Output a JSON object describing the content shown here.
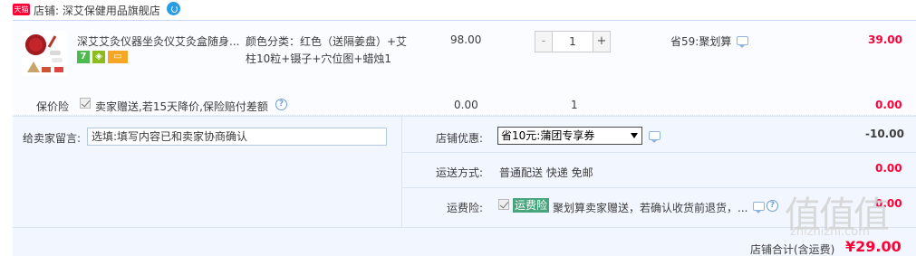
{
  "shop": {
    "badge": "天猫",
    "name": "店铺: 深艾保健用品旗舰店"
  },
  "item": {
    "title": "深艾艾灸仪器坐灸仪艾灸盒随身...",
    "service_icons": [
      "7",
      "cube",
      "card"
    ],
    "sku": "颜色分类：红色（送隔姜盘）+艾柱10粒+镊子+穴位图+蜡烛1",
    "unit_price": "98.00",
    "quantity": "1",
    "qty_minus": "-",
    "qty_plus": "+",
    "promo": "省59:聚划算",
    "subtotal": "39.00"
  },
  "insurance": {
    "label": "保价险",
    "desc": "卖家赠送,若15天降价,保险赔付差额",
    "help": "?",
    "price": "0.00",
    "qty": "1",
    "total": "0.00"
  },
  "message": {
    "label": "给卖家留言:",
    "placeholder": "选填:填写内容已和卖家协商确认"
  },
  "discount": {
    "label": "店铺优惠:",
    "selected": "省10元:蒲团专享券",
    "total": "-10.00"
  },
  "shipping": {
    "label": "运送方式:",
    "value": "普通配送 快递 免邮",
    "total": "0.00"
  },
  "freight": {
    "label": "运费险:",
    "badge": "运费险",
    "desc": "聚划算卖家赠送，若确认收货前退货，...",
    "help": "?",
    "total": "0.00"
  },
  "summary": {
    "label": "店铺合计(含运费)",
    "total": "¥29.00"
  },
  "watermark": {
    "big": "值值值",
    "small": "zhizhizhi.com"
  },
  "colors": {
    "accent_red": "#ff0036",
    "panel_blue": "#f2f7ff",
    "freight_green": "#47a47d",
    "tmall_red": "#ff0036"
  }
}
